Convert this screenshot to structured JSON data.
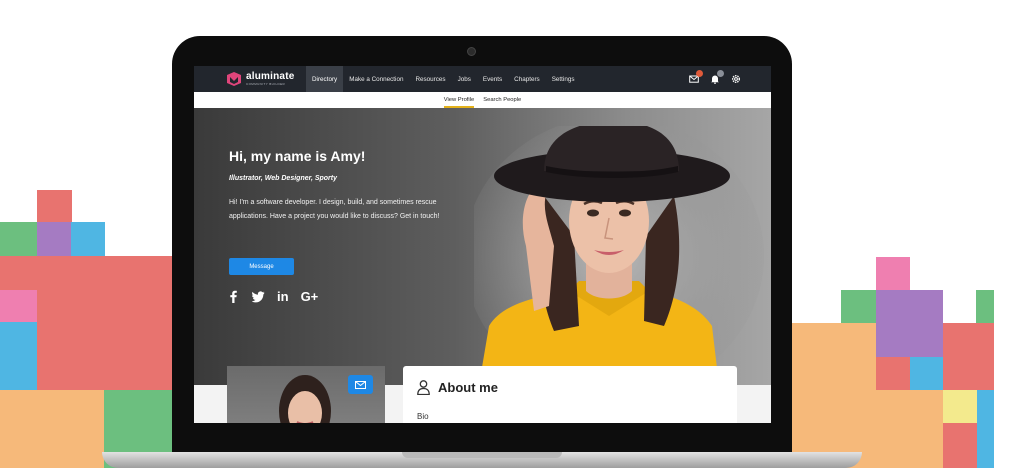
{
  "app": {
    "logo_name": "aluminate",
    "logo_tagline": "COMMUNITY BUILDER"
  },
  "nav": {
    "items": [
      {
        "label": "Directory",
        "active": true
      },
      {
        "label": "Make a Connection",
        "active": false
      },
      {
        "label": "Resources",
        "active": false
      },
      {
        "label": "Jobs",
        "active": false
      },
      {
        "label": "Events",
        "active": false
      },
      {
        "label": "Chapters",
        "active": false
      },
      {
        "label": "Settings",
        "active": false
      }
    ],
    "icons": [
      "mail-icon",
      "bell-icon",
      "gear-icon"
    ],
    "badge_colors": {
      "mail": "#e05a3a",
      "bell": "#8a8f98"
    }
  },
  "subnav": {
    "tabs": [
      {
        "label": "View Profile",
        "active": true
      },
      {
        "label": "Search People",
        "active": false
      }
    ]
  },
  "hero": {
    "title": "Hi, my name is Amy!",
    "subtitle": "Illustrator, Web Designer, Sporty",
    "bio": "Hi! I'm a software developer. I design, build, and sometimes rescue applications. Have a project you would like to discuss? Get in touch!",
    "message_button": "Message",
    "socials": [
      "facebook-icon",
      "twitter-icon",
      "linkedin-icon",
      "google-plus-icon"
    ],
    "social_labels": {
      "linkedin": "in",
      "google_plus": "G+"
    }
  },
  "profile_card": {
    "about_title": "About me",
    "bio_label": "Bio"
  },
  "colors": {
    "nav_bg": "#22262d",
    "accent_blue": "#1e88e5",
    "tab_underline": "#e4b21b",
    "logo_pink": "#e0457b"
  }
}
